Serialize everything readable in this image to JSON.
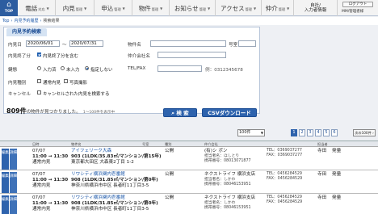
{
  "nav": {
    "top_label": "TOP",
    "menus": [
      {
        "main": "電話",
        "sub": "対応",
        "caret": "▼"
      },
      {
        "main": "内見",
        "sub": "管理",
        "caret": "▼"
      },
      {
        "main": "申込",
        "sub": "管理",
        "caret": "▼"
      },
      {
        "main": "物件",
        "sub": "管理",
        "caret": "▼"
      },
      {
        "main": "お知らせ",
        "sub": "管理",
        "caret": "▼"
      },
      {
        "main": "アクセス",
        "sub": "管理",
        "caret": "▼"
      },
      {
        "main": "仲介",
        "sub": "管理",
        "caret": "▼"
      }
    ],
    "company_line1": "自社/",
    "company_line2": "入力者情報",
    "logout_label": "ログアウト",
    "user_label": "MM/管理者様"
  },
  "breadcrumb": {
    "top": "Top",
    "sep1": "›",
    "item1": "内見予約履歴",
    "sep2": "›",
    "item2": "検索結果"
  },
  "search": {
    "title": "内見予約検索",
    "date_label": "内見日",
    "date_from": "2020/06/01",
    "date_tilde": "～",
    "date_to": "2020/07/31",
    "property_label": "物件名",
    "room_label": "号室",
    "done_label": "内見終了分",
    "done_checkbox_label": "内見終了分を含む",
    "agent_label": "仲介会社名",
    "contact_label": "鍵態",
    "radio_options": [
      "入力済",
      "未入力",
      "指定しない"
    ],
    "tel_label": "TEL/FAX",
    "tel_hint": "例：0312345678",
    "type_label": "内見種別",
    "type_options": [
      "通常内見",
      "写真撮影"
    ],
    "cancel_label": "キャンセル",
    "cancel_checkbox_label": "キャンセルされた内見を検索する",
    "search_button": "検 索",
    "csv_button": "CSVダウンロード",
    "result_prefix": "809件",
    "result_suffix": "の物件が見つかりました。",
    "result_range": "1～100件を表示中"
  },
  "pagination": {
    "per_page": "100件",
    "pages": [
      "1",
      "2",
      "3",
      "4",
      "5",
      "6"
    ],
    "current": "1",
    "next_label": "次の100件 ›"
  },
  "table": {
    "headers": [
      "日時",
      "物件名",
      "号室",
      "種別",
      "",
      "仲介会社",
      "",
      "担当者",
      ""
    ],
    "rows": [
      {
        "b1": "編集",
        "b2": "詳細",
        "date": "07/07",
        "time": "11:00 → 11:30",
        "kind": "通常内見",
        "prop_line1": "アイフェリーク大森",
        "prop_line2": "903 (1LDK/35.83㎡/マンション/第15年)",
        "prop_line3": "東京都大田区 大森東2丁目 1-2",
        "status": "公開",
        "agent_line1": "(有)シ ポン",
        "agent_line2": "担当者名：ほしとり",
        "agent_line3": "携帯番号：08013071877",
        "tel": "TEL：0369037277",
        "fax": "FAX：0369037277",
        "staff": "寺田",
        "staff_status": "発量"
      },
      {
        "b1": "編集",
        "b2": "詳細",
        "date": "07/07",
        "time": "11:00 → 11:30",
        "kind": "通常内見",
        "prop_line1": "リワシティ横浜関内壱番館",
        "prop_line2": "908 (1LDK/31.85㎡/マンション/第0年)",
        "prop_line3": "神奈川県横浜市中区 長者町11丁目3-5",
        "status": "公開",
        "agent_line1": "ネクストライフ 横浜支店",
        "agent_line2": "担当者名：しかわ",
        "agent_line3": "携帯番号：08046153951",
        "tel": "TEL：0456284529",
        "fax": "FAX：0456284529",
        "staff": "寺田",
        "staff_status": "発量"
      },
      {
        "b1": "編集",
        "b2": "詳細",
        "date": "07/07",
        "time": "11:00 → 11:30",
        "kind": "通常内見",
        "prop_line1": "リワシティ横浜関内壱番館",
        "prop_line2": "908 (1LDK/31.85㎡/マンション/第0年)",
        "prop_line3": "神奈川県横浜市中区 長者町11丁目3-5",
        "status": "公開",
        "agent_line1": "ネクストライフ 横浜支店",
        "agent_line2": "担当者名：しかわ",
        "agent_line3": "携帯番号：08046153951",
        "tel": "TEL：0456284529",
        "fax": "FAX：0456284529",
        "staff": "寺田",
        "staff_status": "発量"
      }
    ]
  }
}
